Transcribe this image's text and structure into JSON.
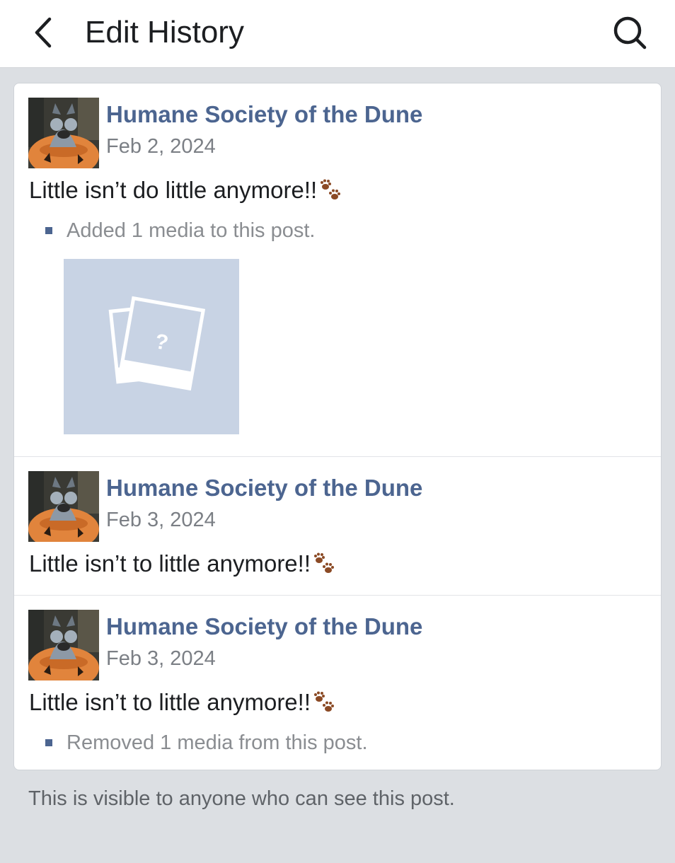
{
  "header": {
    "title": "Edit History",
    "back_icon": "chevron-left-icon",
    "search_icon": "search-icon"
  },
  "entries": [
    {
      "author": "Humane Society of the Dune",
      "date": "Feb 2, 2024",
      "text": "Little isn’t do little anymore!!",
      "emoji": "paw-prints-icon",
      "change": "Added 1 media to this post.",
      "has_media": true
    },
    {
      "author": "Humane Society of the Dune",
      "date": "Feb 3, 2024",
      "text": "Little isn’t to little anymore!!",
      "emoji": "paw-prints-icon",
      "change": "",
      "has_media": false
    },
    {
      "author": "Humane Society of the Dune",
      "date": "Feb 3, 2024",
      "text": "Little isn’t to little anymore!!",
      "emoji": "paw-prints-icon",
      "change": "Removed 1 media from this post.",
      "has_media": false
    }
  ],
  "footer": {
    "note": "This is visible to anyone who can see this post."
  },
  "colors": {
    "author_link": "#4c6590",
    "background": "#dcdfe3",
    "media_placeholder": "#c8d3e4",
    "paw": "#8b4a25"
  }
}
